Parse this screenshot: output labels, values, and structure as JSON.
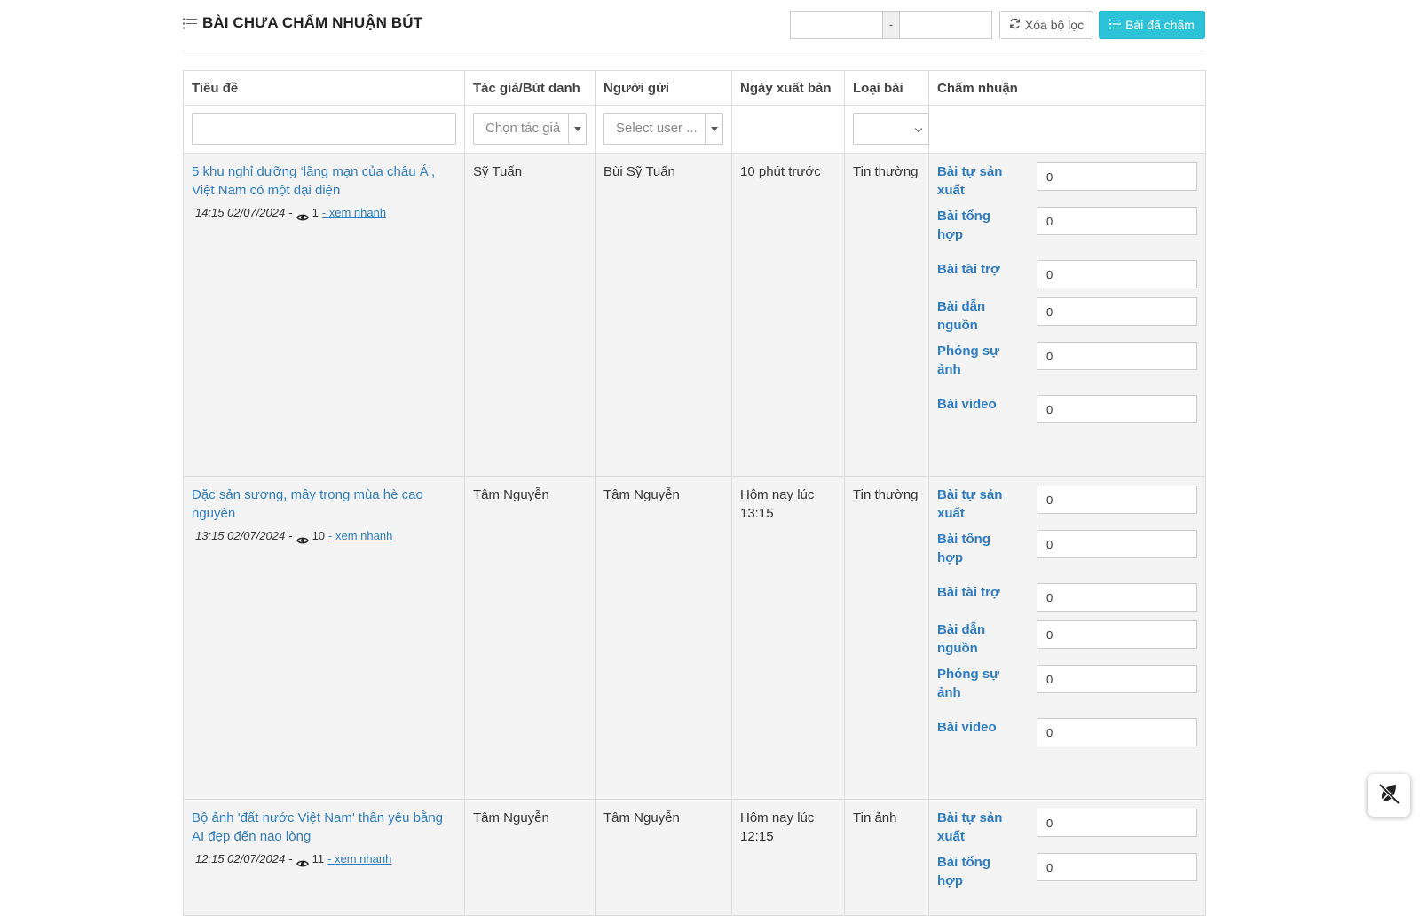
{
  "header": {
    "title": "BÀI CHƯA CHẤM NHUẬN BÚT",
    "date_from": "",
    "date_to": "",
    "date_sep": "-",
    "clear_label": "Xóa bộ lọc",
    "done_label": "Bài đã chấm"
  },
  "table": {
    "columns": [
      "Tiêu đề",
      "Tác giả/Bút danh",
      "Người gửi",
      "Ngày xuất bản",
      "Loại bài",
      "Chấm nhuận"
    ],
    "filters": {
      "title_value": "",
      "author_placeholder": "Chọn tác giả",
      "sender_placeholder": "Select user ...",
      "type_value": ""
    },
    "score_labels": [
      "Bài tự sản xuất",
      "Bài tổng hợp",
      "Bài tài trợ",
      "Bài dẫn nguồn",
      "Phóng sự ảnh",
      "Bài video"
    ],
    "rows": [
      {
        "title": "5 khu nghỉ dưỡng ‘lãng mạn của châu Á’, Việt Nam có một đại diện",
        "time": "14:15 02/07/2024",
        "views": "1",
        "quick": "- xem nhanh",
        "author": "Sỹ Tuấn",
        "sender": "Bùi Sỹ Tuấn",
        "published": "10 phút trước",
        "type": "Tin thường",
        "scores": [
          "0",
          "0",
          "0",
          "0",
          "0",
          "0"
        ]
      },
      {
        "title": "Đặc sản sương, mây trong mùa hè cao nguyên",
        "time": "13:15 02/07/2024",
        "views": "10",
        "quick": "- xem nhanh",
        "author": "Tâm Nguyễn",
        "sender": "Tâm Nguyễn",
        "published": "Hôm nay lúc 13:15",
        "type": "Tin thường",
        "scores": [
          "0",
          "0",
          "0",
          "0",
          "0",
          "0"
        ]
      },
      {
        "title": "Bộ ảnh 'đất nước Việt Nam' thân yêu bằng AI đẹp đến nao lòng",
        "time": "12:15 02/07/2024",
        "views": "11",
        "quick": "- xem nhanh",
        "author": "Tâm Nguyễn",
        "sender": "Tâm Nguyễn",
        "published": "Hôm nay lúc 12:15",
        "type": "Tin ảnh",
        "scores": [
          "0",
          "0"
        ]
      }
    ]
  },
  "icons": {
    "title_icon": "list-icon",
    "clear_icon": "refresh-icon",
    "done_icon": "list-icon",
    "views_icon": "eye-icon",
    "fab_icon": "leaf-slash-icon"
  },
  "colors": {
    "link": "#2e7cc4",
    "primary_button": "#2cc3d8",
    "row_bg": "#f4f4f4"
  }
}
